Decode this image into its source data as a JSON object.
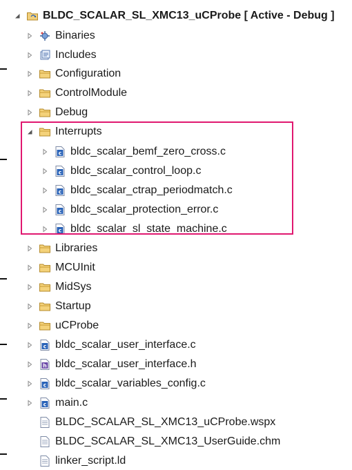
{
  "tree": {
    "root": {
      "label": "BLDC_SCALAR_SL_XMC13_uCProbe [ Active - Debug ]",
      "icon": "project-icon",
      "expanded": true
    },
    "items": [
      {
        "label": "Binaries",
        "icon": "binaries-icon",
        "twisty": "collapsed"
      },
      {
        "label": "Includes",
        "icon": "includes-icon",
        "twisty": "collapsed"
      },
      {
        "label": "Configuration",
        "icon": "folder-icon",
        "twisty": "collapsed"
      },
      {
        "label": "ControlModule",
        "icon": "folder-icon",
        "twisty": "collapsed"
      },
      {
        "label": "Debug",
        "icon": "folder-icon",
        "twisty": "collapsed"
      },
      {
        "label": "Interrupts",
        "icon": "folder-icon",
        "twisty": "expanded"
      },
      {
        "label": "bldc_scalar_bemf_zero_cross.c",
        "icon": "c-file-icon",
        "twisty": "collapsed",
        "child": true
      },
      {
        "label": "bldc_scalar_control_loop.c",
        "icon": "c-file-icon",
        "twisty": "collapsed",
        "child": true
      },
      {
        "label": "bldc_scalar_ctrap_periodmatch.c",
        "icon": "c-file-icon",
        "twisty": "collapsed",
        "child": true
      },
      {
        "label": "bldc_scalar_protection_error.c",
        "icon": "c-file-icon",
        "twisty": "collapsed",
        "child": true
      },
      {
        "label": "bldc_scalar_sl_state_machine.c",
        "icon": "c-file-icon",
        "twisty": "collapsed",
        "child": true
      },
      {
        "label": "Libraries",
        "icon": "folder-icon",
        "twisty": "collapsed"
      },
      {
        "label": "MCUInit",
        "icon": "folder-icon",
        "twisty": "collapsed"
      },
      {
        "label": "MidSys",
        "icon": "folder-icon",
        "twisty": "collapsed"
      },
      {
        "label": "Startup",
        "icon": "folder-icon",
        "twisty": "collapsed"
      },
      {
        "label": "uCProbe",
        "icon": "folder-icon",
        "twisty": "collapsed"
      },
      {
        "label": "bldc_scalar_user_interface.c",
        "icon": "c-file-icon",
        "twisty": "collapsed"
      },
      {
        "label": "bldc_scalar_user_interface.h",
        "icon": "h-file-icon",
        "twisty": "collapsed"
      },
      {
        "label": "bldc_scalar_variables_config.c",
        "icon": "c-file-icon",
        "twisty": "collapsed"
      },
      {
        "label": "main.c",
        "icon": "c-file-icon",
        "twisty": "collapsed"
      },
      {
        "label": "BLDC_SCALAR_SL_XMC13_uCProbe.wspx",
        "icon": "text-file-icon",
        "twisty": "none"
      },
      {
        "label": "BLDC_SCALAR_SL_XMC13_UserGuide.chm",
        "icon": "text-file-icon",
        "twisty": "none"
      },
      {
        "label": "linker_script.ld",
        "icon": "text-file-icon",
        "twisty": "none"
      }
    ]
  },
  "colors": {
    "highlight_border": "#e0176f",
    "folder": "#e8b54a",
    "twisty": "#8a8a8a",
    "c_file": "#2a63b8"
  }
}
